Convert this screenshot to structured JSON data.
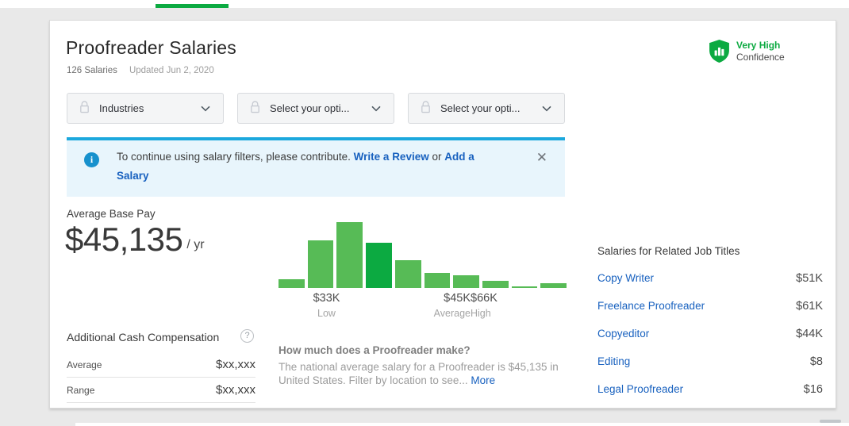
{
  "colors": {
    "green": "#0caa41",
    "link_blue": "#1861bf",
    "banner_border": "#1ca8dd",
    "banner_bg": "#e8f5fc"
  },
  "header": {
    "title": "Proofreader Salaries",
    "salaries_count": "126 Salaries",
    "updated": "Updated Jun 2, 2020",
    "confidence": {
      "level": "Very High",
      "label": "Confidence"
    }
  },
  "filters": [
    {
      "label": "Industries"
    },
    {
      "label": "Select your opti..."
    },
    {
      "label": "Select your opti..."
    }
  ],
  "banner": {
    "text_before": "To continue using salary filters, please contribute. ",
    "link1": "Write a Review",
    "text_mid": " or ",
    "link2": "Add a Salary",
    "close_glyph": "✕",
    "info_glyph": "i"
  },
  "base_pay": {
    "label": "Average Base Pay",
    "amount": "$45,135",
    "per": "/ yr"
  },
  "chart_data": {
    "type": "bar",
    "title": "Proofreader base pay distribution",
    "values": [
      13,
      72,
      100,
      69,
      42,
      23,
      19,
      11,
      3,
      7
    ],
    "highlight_index": 3,
    "bar_color": "#57bb56",
    "highlight_color": "#0caa41",
    "ylim": [
      0,
      100
    ],
    "grid": false,
    "x_ticks": [
      {
        "value": "$33K",
        "label": "Low"
      },
      {
        "value": "$45K",
        "label": "Average"
      },
      {
        "value": "$66K",
        "label": "High"
      }
    ]
  },
  "additional_comp": {
    "title": "Additional Cash Compensation",
    "help_glyph": "?",
    "rows": [
      {
        "label": "Average",
        "value": "$xx,xxx"
      },
      {
        "label": "Range",
        "value": "$xx,xxx"
      }
    ]
  },
  "about": {
    "title": "How much does a Proofreader make?",
    "body": "The national average salary for a Proofreader is $45,135 in United States. Filter by location to see... ",
    "more": "More"
  },
  "related": {
    "title": "Salaries for Related Job Titles",
    "items": [
      {
        "title": "Copy Writer",
        "salary": "$51K"
      },
      {
        "title": "Freelance Proofreader",
        "salary": "$61K"
      },
      {
        "title": "Copyeditor",
        "salary": "$44K"
      },
      {
        "title": "Editing",
        "salary": "$8"
      },
      {
        "title": "Legal Proofreader",
        "salary": "$16"
      }
    ]
  }
}
